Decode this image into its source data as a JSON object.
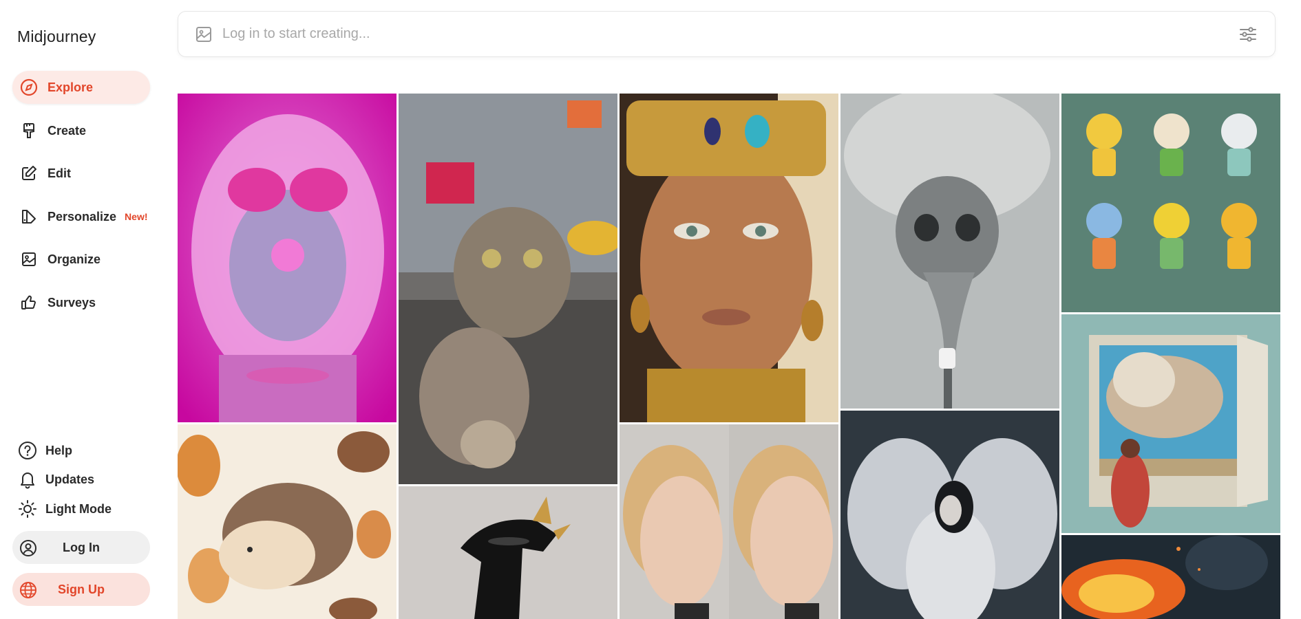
{
  "app": {
    "brand": "Midjourney"
  },
  "nav": {
    "explore": "Explore",
    "create": "Create",
    "edit": "Edit",
    "personalize": "Personalize",
    "personalize_badge": "New!",
    "organize": "Organize",
    "surveys": "Surveys"
  },
  "footer": {
    "help": "Help",
    "updates": "Updates",
    "light_mode": "Light Mode",
    "log_in": "Log In",
    "sign_up": "Sign Up"
  },
  "search": {
    "placeholder": "Log in to start creating..."
  },
  "colors": {
    "accent": "#e2462a",
    "active_bg": "#fdeae6",
    "signup_bg": "#fbe2dd"
  },
  "gallery": [
    {
      "name": "pink-bubblegum-girl"
    },
    {
      "name": "cat-selfie-times-square"
    },
    {
      "name": "egyptian-queen-portrait"
    },
    {
      "name": "smoke-skull-car"
    },
    {
      "name": "toy-adventurer-figures"
    },
    {
      "name": "hedgehog-autumn-pattern"
    },
    {
      "name": "black-ceramic-dragon"
    },
    {
      "name": "blonde-woman-side-profiles"
    },
    {
      "name": "white-winged-angel"
    },
    {
      "name": "girl-window-cloud"
    },
    {
      "name": "fire-explosion"
    }
  ]
}
